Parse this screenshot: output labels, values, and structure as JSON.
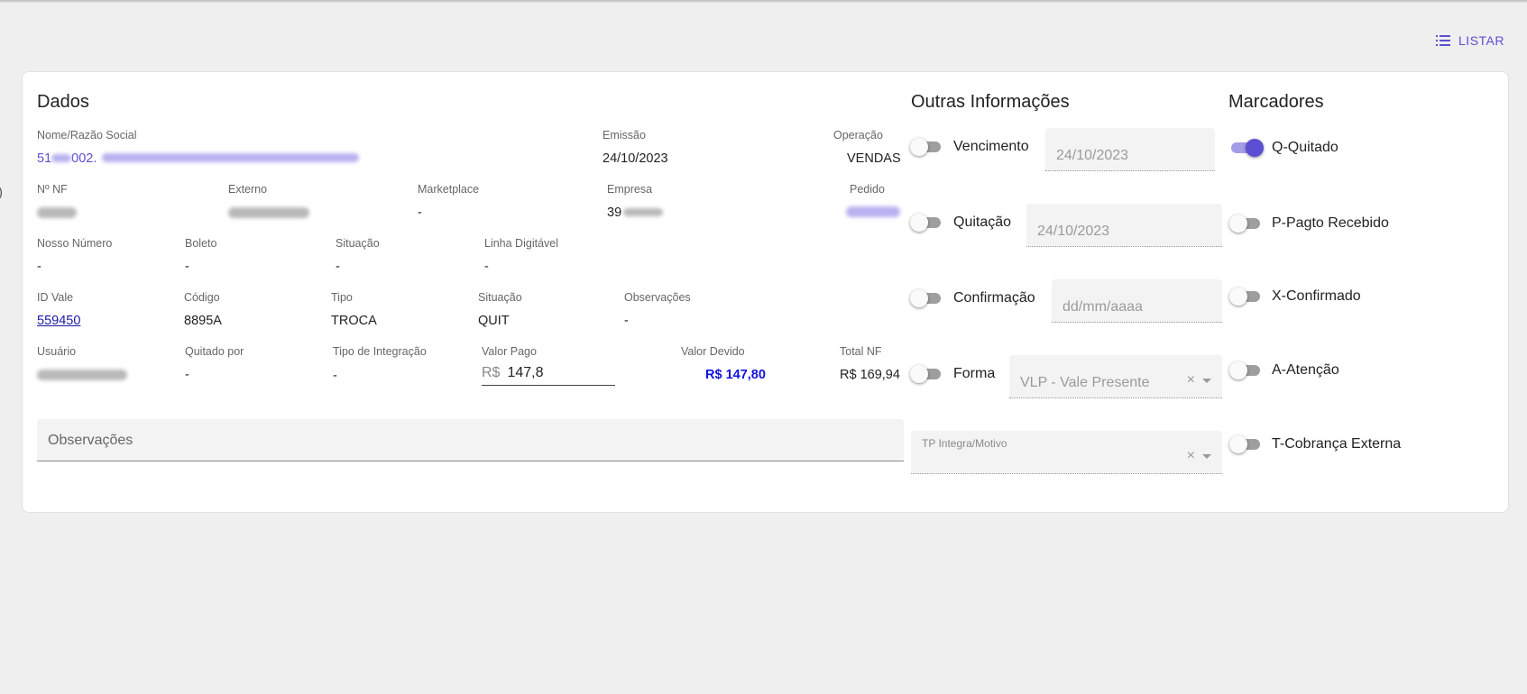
{
  "toolbar": {
    "listar_label": "LISTAR",
    "list_icon": "list-icon"
  },
  "left_edge_glyph": ")",
  "colors": {
    "accent": "#5b4fd3",
    "link": "#1a1aa6",
    "amount_due": "#1111dd"
  },
  "dados": {
    "title": "Dados",
    "nome": {
      "label": "Nome/Razão Social",
      "value": "51",
      "value_b": "002."
    },
    "emissao": {
      "label": "Emissão",
      "value": "24/10/2023"
    },
    "operacao": {
      "label": "Operação",
      "value": "VENDAS"
    },
    "nf": {
      "label": "Nº NF"
    },
    "externo": {
      "label": "Externo"
    },
    "marketplace": {
      "label": "Marketplace",
      "value": "-"
    },
    "empresa": {
      "label": "Empresa",
      "value": "39"
    },
    "pedido": {
      "label": "Pedido"
    },
    "nosso_numero": {
      "label": "Nosso Número",
      "value": "-"
    },
    "boleto": {
      "label": "Boleto",
      "value": "-"
    },
    "situacao_boleto": {
      "label": "Situação",
      "value": "-"
    },
    "linha_digitavel": {
      "label": "Linha Digitável",
      "value": "-"
    },
    "id_vale": {
      "label": "ID Vale",
      "value": "559450"
    },
    "codigo": {
      "label": "Código",
      "value": "8895A"
    },
    "tipo": {
      "label": "Tipo",
      "value": "TROCA"
    },
    "situacao_vale": {
      "label": "Situação",
      "value": "QUIT"
    },
    "observacoes_vale": {
      "label": "Observações",
      "value": "-"
    },
    "usuario": {
      "label": "Usuário"
    },
    "quitado_por": {
      "label": "Quitado por",
      "value": "-"
    },
    "tipo_integracao": {
      "label": "Tipo de Integração",
      "value": "-"
    },
    "valor_pago": {
      "label": "Valor Pago",
      "prefix": "R$",
      "value": "147,8"
    },
    "valor_devido": {
      "label": "Valor Devido",
      "value": "R$ 147,80"
    },
    "total_nf": {
      "label": "Total NF",
      "value": "R$ 169,94"
    },
    "observacoes_placeholder": "Observações"
  },
  "outras": {
    "title": "Outras Informações",
    "vencimento": {
      "label": "Vencimento",
      "value": "24/10/2023",
      "on": false
    },
    "quitacao": {
      "label": "Quitação",
      "value": "24/10/2023",
      "on": false
    },
    "confirmacao": {
      "label": "Confirmação",
      "placeholder": "dd/mm/aaaa",
      "on": false
    },
    "forma": {
      "label": "Forma",
      "value": "VLP - Vale Presente",
      "on": false
    },
    "tp_integra": {
      "label": "TP Integra/Motivo"
    }
  },
  "marcadores": {
    "title": "Marcadores",
    "items": [
      {
        "label": "Q-Quitado",
        "on": true
      },
      {
        "label": "P-Pagto Recebido",
        "on": false
      },
      {
        "label": "X-Confirmado",
        "on": false
      },
      {
        "label": "A-Atenção",
        "on": false
      },
      {
        "label": "T-Cobrança Externa",
        "on": false
      }
    ]
  }
}
